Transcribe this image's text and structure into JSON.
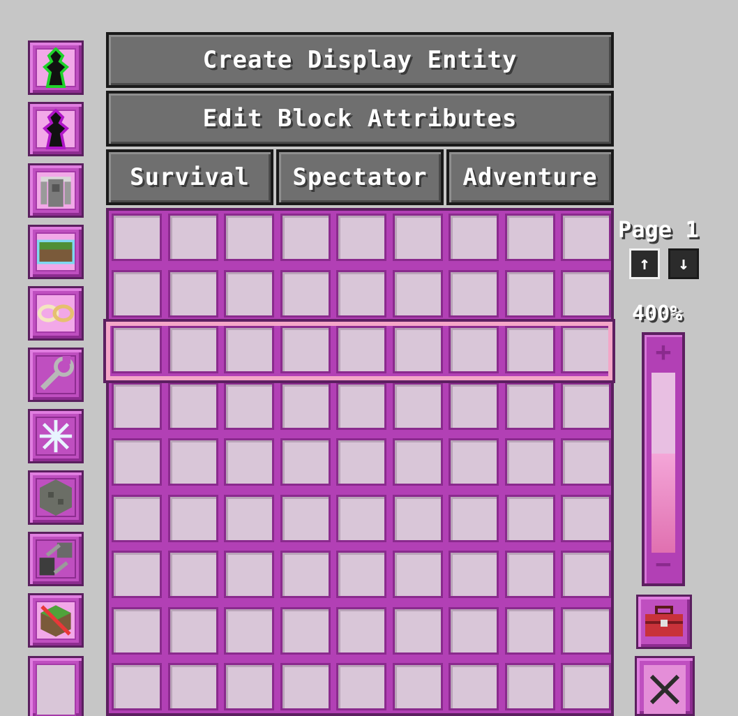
{
  "buttons": {
    "create_display_entity": "Create Display Entity",
    "edit_block_attributes": "Edit Block Attributes",
    "survival": "Survival",
    "spectator": "Spectator",
    "adventure": "Adventure"
  },
  "sidebar": {
    "items": [
      {
        "icon": "green-outline-figure-icon"
      },
      {
        "icon": "purple-outline-figure-icon"
      },
      {
        "icon": "armor-stand-icon"
      },
      {
        "icon": "grass-block-glass-icon"
      },
      {
        "icon": "infinity-chain-icon"
      },
      {
        "icon": "wrench-icon"
      },
      {
        "icon": "snowflake-icon"
      },
      {
        "icon": "stone-block-icon"
      },
      {
        "icon": "transform-arrows-icon"
      },
      {
        "icon": "no-grass-block-icon"
      },
      {
        "icon": "empty-slot"
      }
    ]
  },
  "grid": {
    "rows": 9,
    "cols": 9,
    "highlighted_row": 3
  },
  "paging": {
    "label": "Page 1",
    "up": "↑",
    "down": "↓"
  },
  "zoom": {
    "label": "400%",
    "level": 0.55,
    "plus": "+",
    "minus": "−"
  },
  "toolbox": {
    "icon": "toolbox-icon"
  },
  "close": {
    "icon": "close-x-icon"
  },
  "colors": {
    "accent": "#bf4fc0",
    "slot": "#d9c6d8",
    "button": "#6f6f6f",
    "background": "#c6c6c6"
  }
}
